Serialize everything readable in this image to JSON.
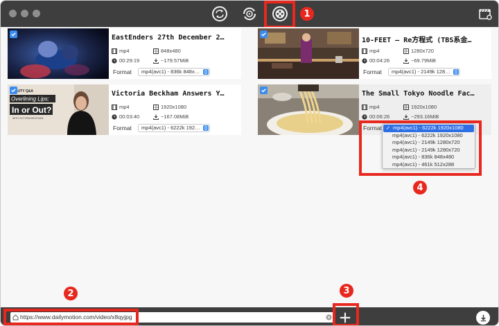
{
  "colors": {
    "accent": "#3b8cf0",
    "highlight": "#e8281e",
    "chrome": "#3e3e3e",
    "dropdown_selected": "#2f6fe4"
  },
  "toolbar": {
    "buttons": [
      {
        "icon": "convert-icon"
      },
      {
        "icon": "burn-icon"
      },
      {
        "icon": "download-film-icon",
        "active": true
      }
    ],
    "right_icon": "video-settings-icon"
  },
  "markers": {
    "m1": "1",
    "m2": "2",
    "m3": "3",
    "m4": "4"
  },
  "videos": [
    {
      "title": "EastEnders 27th December 2…",
      "container": "mp4",
      "resolution": "848x480",
      "duration": "00:29:19",
      "size": "~179.57MiB",
      "format_label": "Format",
      "format": "mp4(avc1) - 836k 848x…",
      "checked": true
    },
    {
      "title": "10-FEET – Re方程式 (TBS系金…",
      "container": "mp4",
      "resolution": "1280x720",
      "duration": "00:04:26",
      "size": "~69.79MiB",
      "format_label": "Format",
      "format": "mp4(avc1) - 2149k 128…",
      "checked": true
    },
    {
      "title": "Victoria Beckham Answers Y…",
      "container": "mp4",
      "resolution": "1920x1080",
      "duration": "00:03:40",
      "size": "~167.08MiB",
      "format_label": "Format",
      "format": "mp4(avc1) - 6222k 192…",
      "checked": true
    },
    {
      "title": "The Small Tokyo Noodle Fac…",
      "container": "mp4",
      "resolution": "1920x1080",
      "duration": "00:06:26",
      "size": "~293.16MiB",
      "format_label": "Format",
      "checked": true
    }
  ],
  "thumb_text": {
    "beauty": "BEAUTY Q&A",
    "line1": "Overlining Lips:",
    "line2": "In or Out?",
    "with": "WITH VICTORIA BECKHAM"
  },
  "format_dropdown": {
    "selected_index": 0,
    "options": [
      "mp4(avc1) - 6222k 1920x1080",
      "mp4(avc1) - 6222k 1920x1080",
      "mp4(avc1) - 2149k 1280x720",
      "mp4(avc1) - 2149k 1280x720",
      "mp4(avc1) - 836k 848x480",
      "mp4(avc1) - 461k 512x288"
    ]
  },
  "bottom": {
    "url": "https://www.dailymotion.com/video/x8qyjpg",
    "add_icon": "plus-icon",
    "download_icon": "download-icon"
  }
}
